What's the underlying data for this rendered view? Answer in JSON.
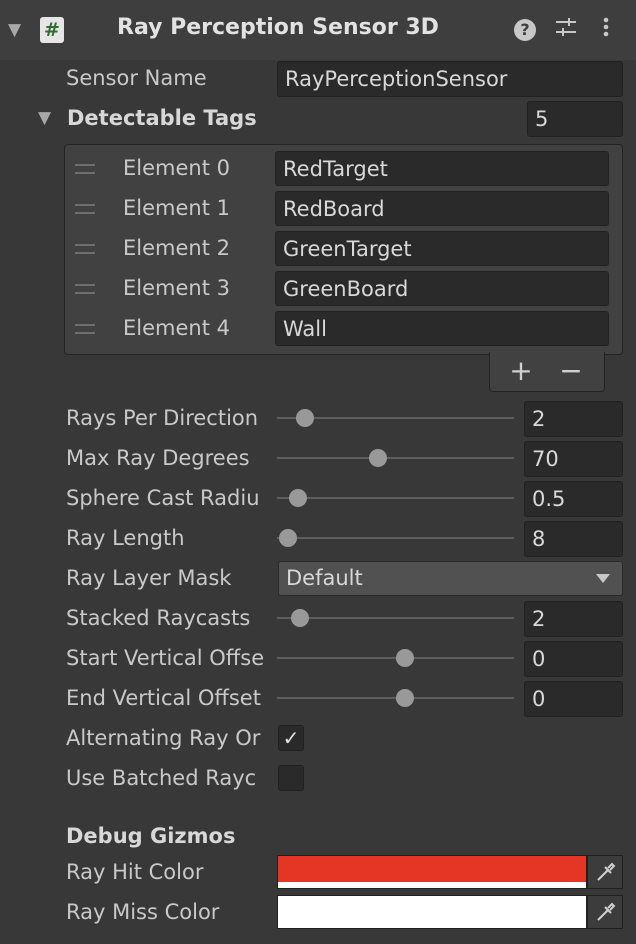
{
  "header": {
    "title": "Ray Perception Sensor 3D",
    "script_icon_glyph": "#",
    "icons": [
      "foldout-arrow",
      "help-icon",
      "preset-sliders-icon",
      "more-vert-icon"
    ]
  },
  "sensor_name": {
    "label": "Sensor Name",
    "value": "RayPerceptionSensor"
  },
  "detectable_tags": {
    "label": "Detectable Tags",
    "size": "5",
    "elements": [
      {
        "label": "Element 0",
        "value": "RedTarget"
      },
      {
        "label": "Element 1",
        "value": "RedBoard"
      },
      {
        "label": "Element 2",
        "value": "GreenTarget"
      },
      {
        "label": "Element 3",
        "value": "GreenBoard"
      },
      {
        "label": "Element 4",
        "value": "Wall"
      }
    ],
    "add_label": "+",
    "remove_label": "−"
  },
  "sliders": {
    "rays_per_direction": {
      "label": "Rays Per Direction",
      "value": "2",
      "fraction": 0.08
    },
    "max_ray_degrees": {
      "label": "Max Ray Degrees",
      "value": "70",
      "fraction": 0.39
    },
    "sphere_cast_radius": {
      "label": "Sphere Cast Radiu",
      "value": "0.5",
      "fraction": 0.05
    },
    "ray_length": {
      "label": "Ray Length",
      "value": "8",
      "fraction": 0.01
    },
    "stacked_raycasts": {
      "label": "Stacked Raycasts",
      "value": "2",
      "fraction": 0.06
    },
    "start_vertical_offset": {
      "label": "Start Vertical Offse",
      "value": "0",
      "fraction": 0.5
    },
    "end_vertical_offset": {
      "label": "End Vertical Offset",
      "value": "0",
      "fraction": 0.5
    }
  },
  "ray_layer_mask": {
    "label": "Ray Layer Mask",
    "value": "Default"
  },
  "alternating_ray_order": {
    "label": "Alternating Ray Or",
    "checked": true,
    "check_glyph": "✓"
  },
  "use_batched_raycasts": {
    "label": "Use Batched Rayc",
    "checked": false
  },
  "debug_gizmos": {
    "label": "Debug Gizmos",
    "ray_hit_color": {
      "label": "Ray Hit Color",
      "color": "#e53524"
    },
    "ray_miss_color": {
      "label": "Ray Miss Color",
      "color": "#ffffff"
    }
  }
}
